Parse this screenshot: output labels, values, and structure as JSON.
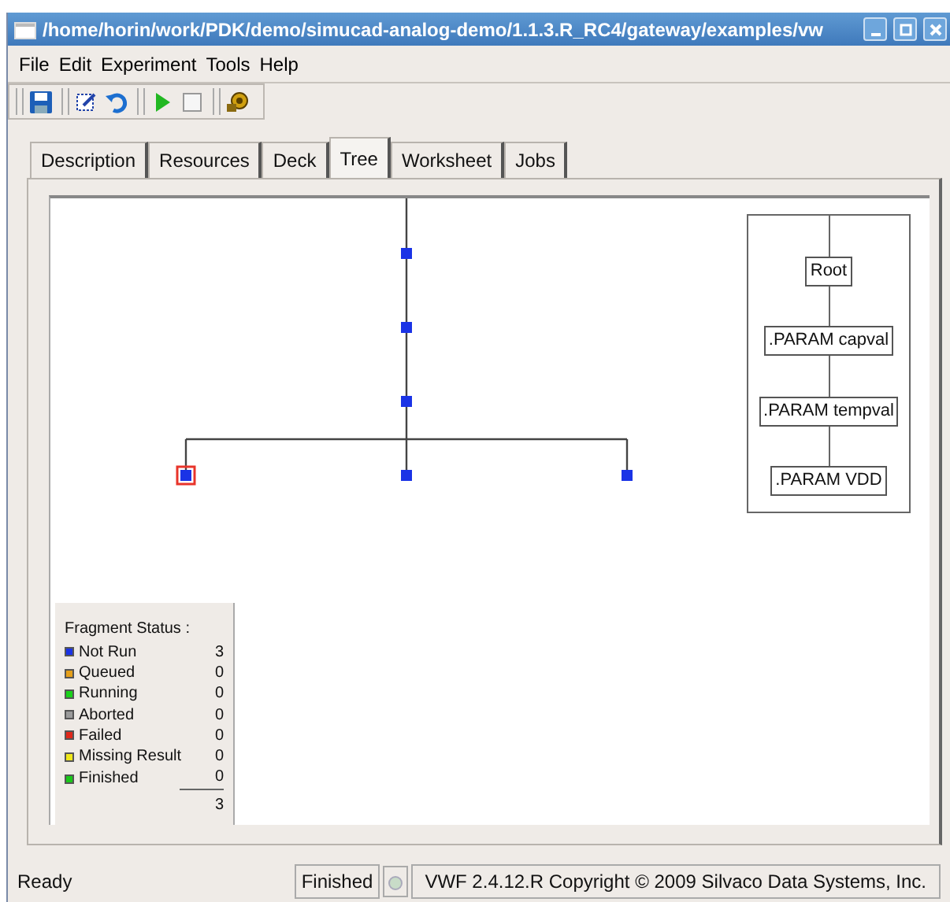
{
  "window": {
    "title": "/home/horin/work/PDK/demo/simucad-analog-demo/1.1.3.R_RC4/gateway/examples/vw"
  },
  "menu": [
    "File",
    "Edit",
    "Experiment",
    "Tools",
    "Help"
  ],
  "toolbar": [
    {
      "kind": "save"
    },
    {
      "kind": "sep"
    },
    {
      "kind": "edit"
    },
    {
      "kind": "refresh"
    },
    {
      "kind": "sep"
    },
    {
      "kind": "run"
    },
    {
      "kind": "stop"
    },
    {
      "kind": "sep"
    },
    {
      "kind": "tools"
    }
  ],
  "tabs": [
    {
      "label": "Description",
      "selected": false
    },
    {
      "label": "Resources",
      "selected": false
    },
    {
      "label": "Deck",
      "selected": false
    },
    {
      "label": "Tree",
      "selected": true
    },
    {
      "label": "Worksheet",
      "selected": false
    },
    {
      "label": "Jobs",
      "selected": false
    }
  ],
  "tree": {
    "children": [
      {
        "selected": false,
        "color": "#1a33e6",
        "children": [
          {
            "selected": false,
            "color": "#1a33e6",
            "children": [
              {
                "selected": false,
                "color": "#1a33e6",
                "children": [
                  {
                    "selected": true,
                    "color": "#1a33e6"
                  },
                  {
                    "selected": false,
                    "color": "#1a33e6"
                  },
                  {
                    "selected": false,
                    "color": "#1a33e6"
                  }
                ]
              }
            ]
          }
        ]
      }
    ]
  },
  "params": [
    "Root",
    ".PARAM capval",
    ".PARAM tempval",
    ".PARAM VDD"
  ],
  "legend": {
    "title": "Fragment Status :",
    "items": [
      {
        "label": "Not Run",
        "count": "3",
        "color": "#1a33e6"
      },
      {
        "label": "Queued",
        "count": "0",
        "color": "#e6a01a"
      },
      {
        "label": "Running",
        "count": "0",
        "color": "#1ad21a"
      },
      {
        "label": "Aborted",
        "count": "0",
        "color": "#9a9a9a"
      },
      {
        "label": "Failed",
        "count": "0",
        "color": "#e0281a"
      },
      {
        "label": "Missing Result",
        "count": "0",
        "color": "#f0e81a"
      },
      {
        "label": "Finished",
        "count": "0",
        "color": "#1ac81a"
      }
    ],
    "total": "3"
  },
  "status_bar": {
    "message": "Ready",
    "state": "Finished",
    "led_on": false,
    "copyright": "VWF 2.4.12.R Copyright © 2009 Silvaco Data Systems, Inc."
  }
}
